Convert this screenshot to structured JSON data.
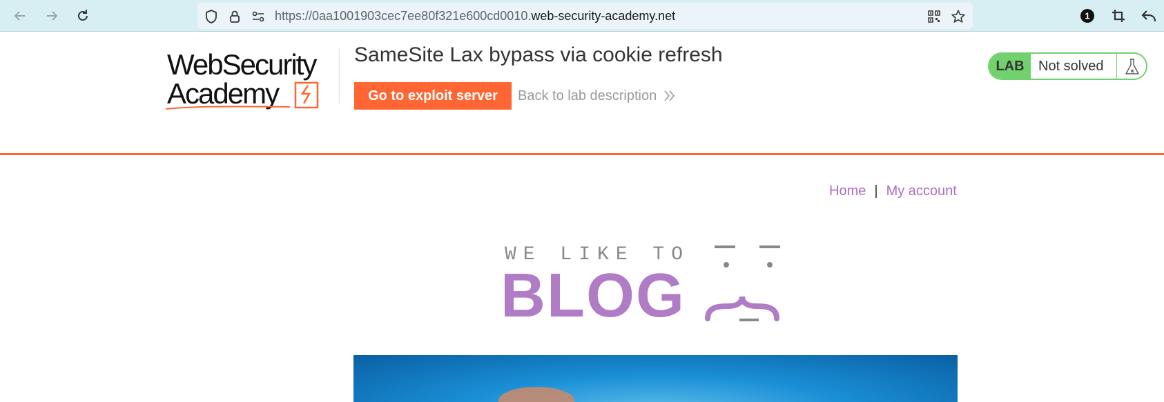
{
  "browser": {
    "url_prefix": "https://0aa1001903cec7ee80f321e600cd0010.",
    "url_domain": "web-security-academy.net",
    "extension_badge": "1"
  },
  "header": {
    "logo_alt": "Web Security Academy",
    "lab_title": "SameSite Lax bypass via cookie refresh",
    "exploit_button": "Go to exploit server",
    "back_link": "Back to lab description",
    "status": {
      "lab_label": "LAB",
      "text": "Not solved",
      "color": "#70d16d"
    }
  },
  "nav": {
    "home": "Home",
    "separator": "|",
    "my_account": "My account"
  },
  "blog_logo": {
    "line1": "WE LIKE TO",
    "line2": "BLOG"
  },
  "colors": {
    "accent_orange": "#ff6633",
    "link_purple": "#b06cc4",
    "blog_purple": "#b07cc6"
  }
}
